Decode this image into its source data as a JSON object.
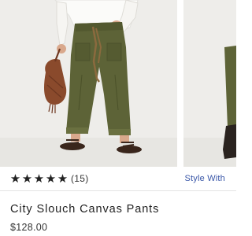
{
  "carousel": {
    "images": [
      {
        "icon": "product-photo-front",
        "alt_visible": false
      },
      {
        "icon": "product-photo-peek",
        "alt_visible": false
      }
    ]
  },
  "rating": {
    "stars": [
      "★",
      "★",
      "★",
      "★",
      "★"
    ],
    "star_value": 5,
    "star_max": 5,
    "review_count": "(15)"
  },
  "style_with": {
    "label": "Style With"
  },
  "product": {
    "title": "City Slouch Canvas Pants",
    "price": "$128.00"
  },
  "colors": {
    "accent_link": "#3a57a8",
    "text_primary": "#222222",
    "pants_olive": "#5d6337",
    "backdrop": "#eeedea"
  }
}
